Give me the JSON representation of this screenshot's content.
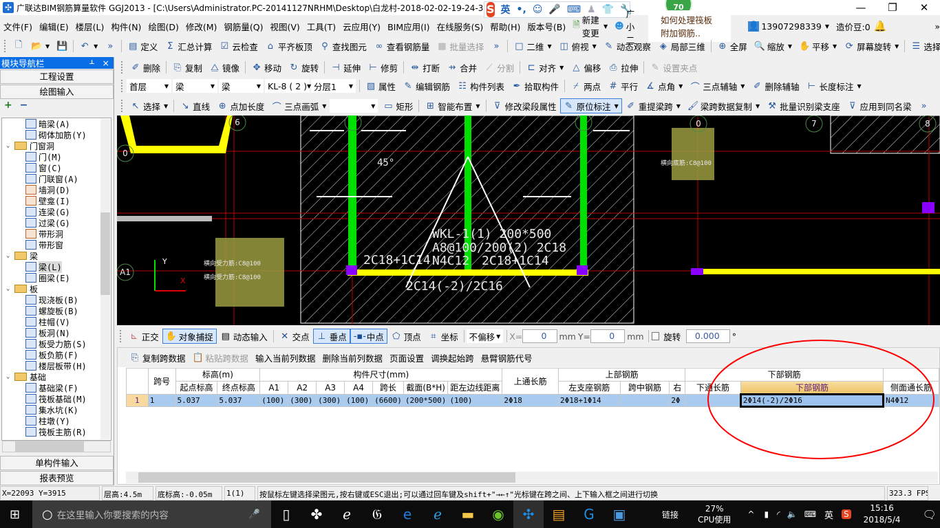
{
  "titlebar": {
    "title": "广联达BIM钢筋算量软件 GGJ2013 - [C:\\Users\\Administrator.PC-20141127NRHM\\Desktop\\白龙村-2018-02-02-19-24-35",
    "ime_lang": "英",
    "badge": "70",
    "minimize": "—",
    "restore": "❐",
    "close": "✕"
  },
  "menu": {
    "items": [
      "文件(F)",
      "编辑(E)",
      "楼层(L)",
      "构件(N)",
      "绘图(D)",
      "修改(M)",
      "钢筋量(Q)",
      "视图(V)",
      "工具(T)",
      "云应用(Y)",
      "BIM应用(I)",
      "在线服务(S)",
      "帮助(H)",
      "版本号(B)"
    ],
    "new_change": "新建变更",
    "assistant": "广小二",
    "question": "如何处理筏板附加钢筋..",
    "account": "13907298339",
    "beans": "造价豆:0"
  },
  "toolbar1": [
    {
      "label": "",
      "icon": "new-file-icon",
      "g": "🗋"
    },
    {
      "label": "",
      "icon": "open-folder-icon",
      "g": "📂",
      "dd": true
    },
    {
      "label": "",
      "icon": "save-icon",
      "g": "💾"
    },
    {
      "sep": true
    },
    {
      "label": "",
      "icon": "undo-icon",
      "g": "↶",
      "dd": true
    },
    {
      "label": "",
      "icon": "more-icon",
      "g": "»"
    },
    {
      "sep": true
    },
    {
      "label": "定义",
      "icon": "define-icon",
      "g": "▤"
    },
    {
      "label": "汇总计算",
      "icon": "sigma-icon",
      "g": "Σ"
    },
    {
      "label": "云检查",
      "icon": "cloud-check-icon",
      "g": "☑"
    },
    {
      "label": "平齐板顶",
      "icon": "align-top-icon",
      "g": "⌂"
    },
    {
      "label": "查找图元",
      "icon": "binoculars-icon",
      "g": "⚲"
    },
    {
      "label": "查看钢筋量",
      "icon": "glasses-icon",
      "g": "∞"
    },
    {
      "label": "批量选择",
      "icon": "batch-select-icon",
      "g": "▦",
      "disabled": true
    },
    {
      "label": "",
      "icon": "more-icon",
      "g": "»"
    },
    {
      "sep": true
    },
    {
      "label": "二维",
      "icon": "2d-icon",
      "g": "□",
      "dd": true
    },
    {
      "label": "俯视",
      "icon": "top-view-icon",
      "g": "◫",
      "dd": true
    },
    {
      "label": "动态观察",
      "icon": "orbit-icon",
      "g": "✎"
    },
    {
      "label": "局部三维",
      "icon": "local-3d-icon",
      "g": "◈"
    },
    {
      "sep": true
    },
    {
      "label": "全屏",
      "icon": "fullscreen-icon",
      "g": "⊕"
    },
    {
      "label": "缩放",
      "icon": "zoom-icon",
      "g": "🔍",
      "dd": true
    },
    {
      "label": "平移",
      "icon": "pan-icon",
      "g": "✋",
      "dd": true
    },
    {
      "label": "屏幕旋转",
      "icon": "screen-rotate-icon",
      "g": "⟳",
      "dd": true
    },
    {
      "sep": true
    },
    {
      "label": "选择楼层",
      "icon": "select-floor-icon",
      "g": "☰"
    }
  ],
  "toolbar2": [
    {
      "label": "删除",
      "icon": "delete-icon",
      "g": "✐"
    },
    {
      "sep": true
    },
    {
      "label": "复制",
      "icon": "copy-icon",
      "g": "⎘"
    },
    {
      "label": "镜像",
      "icon": "mirror-icon",
      "g": "⧋"
    },
    {
      "sep": true
    },
    {
      "label": "移动",
      "icon": "move-icon",
      "g": "✥"
    },
    {
      "label": "旋转",
      "icon": "rotate-icon",
      "g": "↻"
    },
    {
      "sep": true
    },
    {
      "label": "延伸",
      "icon": "extend-icon",
      "g": "⊣"
    },
    {
      "label": "修剪",
      "icon": "trim-icon",
      "g": "⊢"
    },
    {
      "sep": true
    },
    {
      "label": "打断",
      "icon": "break-icon",
      "g": "⇹"
    },
    {
      "label": "合并",
      "icon": "merge-icon",
      "g": "⇸"
    },
    {
      "label": "分割",
      "icon": "split-icon",
      "g": "⟋",
      "disabled": true
    },
    {
      "sep": true
    },
    {
      "label": "对齐",
      "icon": "align-icon",
      "g": "⊏",
      "dd": true
    },
    {
      "label": "偏移",
      "icon": "offset-icon",
      "g": "△"
    },
    {
      "label": "拉伸",
      "icon": "stretch-icon",
      "g": "⎙"
    },
    {
      "sep": true
    },
    {
      "label": "设置夹点",
      "icon": "grip-point-icon",
      "g": "✎",
      "disabled": true
    }
  ],
  "toolbar3": {
    "selects": [
      {
        "value": "首层",
        "w": 65
      },
      {
        "value": "梁",
        "w": 55
      },
      {
        "value": "梁",
        "w": 55
      },
      {
        "value": "KL-8 ( 2 )",
        "w": 55
      },
      {
        "value": "分层1",
        "w": 55
      }
    ],
    "items": [
      {
        "sep": true
      },
      {
        "label": "属性",
        "icon": "properties-icon",
        "g": "▧"
      },
      {
        "label": "编辑钢筋",
        "icon": "edit-rebar-icon",
        "g": "✎"
      },
      {
        "label": "构件列表",
        "icon": "component-list-icon",
        "g": "☷"
      },
      {
        "label": "拾取构件",
        "icon": "eyedropper-icon",
        "g": "✒"
      },
      {
        "sep": true
      },
      {
        "label": "两点",
        "icon": "two-point-icon",
        "g": "⌿"
      },
      {
        "label": "平行",
        "icon": "parallel-icon",
        "g": "#"
      },
      {
        "label": "点角",
        "icon": "point-angle-icon",
        "g": "∡",
        "dd": true
      },
      {
        "label": "三点辅轴",
        "icon": "three-point-axis-icon",
        "g": "⌒",
        "dd": true
      },
      {
        "label": "删除辅轴",
        "icon": "delete-axis-icon",
        "g": "✐"
      },
      {
        "label": "长度标注",
        "icon": "length-dimension-icon",
        "g": "⊢",
        "dd": true
      }
    ]
  },
  "toolbar4": [
    {
      "label": "选择",
      "icon": "cursor-icon",
      "g": "↖",
      "dd": true
    },
    {
      "sep": true
    },
    {
      "label": "直线",
      "icon": "line-icon",
      "g": "↘"
    },
    {
      "label": "点加长度",
      "icon": "point-length-icon",
      "g": "⊕"
    },
    {
      "label": "三点画弧",
      "icon": "arc-icon",
      "g": "⌒",
      "dd": true
    },
    {
      "select": true,
      "value": ""
    },
    {
      "label": "矩形",
      "icon": "rectangle-icon",
      "g": "▭"
    },
    {
      "sep": true
    },
    {
      "label": "智能布置",
      "icon": "smart-layout-icon",
      "g": "⊞",
      "dd": true
    },
    {
      "sep": true
    },
    {
      "label": "修改梁段属性",
      "icon": "filter-icon",
      "g": "⊽"
    },
    {
      "label": "原位标注",
      "icon": "in-place-annotation-icon",
      "g": "✎",
      "active": true,
      "dd": true
    },
    {
      "label": "重提梁跨",
      "icon": "re-extract-span-icon",
      "g": "✐",
      "dd": true
    },
    {
      "label": "梁跨数据复制",
      "icon": "brush-icon",
      "g": "🖌",
      "dd": true
    },
    {
      "label": "批量识别梁支座",
      "icon": "batch-support-icon",
      "g": "⚒"
    },
    {
      "label": "应用到同名梁",
      "icon": "apply-same-name-icon",
      "g": "⊽"
    },
    {
      "label": "",
      "icon": "more-icon",
      "g": "»"
    }
  ],
  "left_panel": {
    "title": "模块导航栏",
    "pin": "ᚆ",
    "close": "×",
    "project_settings": "工程设置",
    "drawing_input": "绘图输入",
    "expand": "+",
    "collapse": "−",
    "single_input": "单构件输入",
    "report_preview": "报表预览",
    "tree": [
      {
        "l": 2,
        "t": "暗梁(A)",
        "icon": "hidden-beam-icon"
      },
      {
        "l": 2,
        "t": "砌体加筋(Y)",
        "icon": "masonry-rebar-icon"
      },
      {
        "l": 1,
        "t": "门窗洞",
        "icon": "folder-icon",
        "f": true
      },
      {
        "l": 2,
        "t": "门(M)",
        "icon": "door-icon"
      },
      {
        "l": 2,
        "t": "窗(C)",
        "icon": "window-icon"
      },
      {
        "l": 2,
        "t": "门联窗(A)",
        "icon": "door-window-icon"
      },
      {
        "l": 2,
        "t": "墙洞(D)",
        "icon": "wall-hole-icon",
        "c": "#c0622b"
      },
      {
        "l": 2,
        "t": "壁龛(I)",
        "icon": "niche-icon",
        "c": "#c0622b"
      },
      {
        "l": 2,
        "t": "连梁(G)",
        "icon": "coupling-beam-icon"
      },
      {
        "l": 2,
        "t": "过梁(G)",
        "icon": "lintel-icon"
      },
      {
        "l": 2,
        "t": "带形洞",
        "icon": "strip-hole-icon",
        "c": "#c0622b"
      },
      {
        "l": 2,
        "t": "带形窗",
        "icon": "strip-window-icon"
      },
      {
        "l": 1,
        "t": "梁",
        "icon": "folder-icon",
        "f": true
      },
      {
        "l": 2,
        "t": "梁(L)",
        "icon": "beam-icon",
        "sel": true
      },
      {
        "l": 2,
        "t": "圈梁(E)",
        "icon": "ring-beam-icon"
      },
      {
        "l": 1,
        "t": "板",
        "icon": "folder-icon",
        "f": true
      },
      {
        "l": 2,
        "t": "现浇板(B)",
        "icon": "cast-slab-icon"
      },
      {
        "l": 2,
        "t": "螺旋板(B)",
        "icon": "spiral-slab-icon"
      },
      {
        "l": 2,
        "t": "柱帽(V)",
        "icon": "column-cap-icon"
      },
      {
        "l": 2,
        "t": "板洞(N)",
        "icon": "slab-hole-icon"
      },
      {
        "l": 2,
        "t": "板受力筋(S)",
        "icon": "slab-stress-rebar-icon"
      },
      {
        "l": 2,
        "t": "板负筋(F)",
        "icon": "slab-negative-rebar-icon"
      },
      {
        "l": 2,
        "t": "楼层板带(H)",
        "icon": "floor-strip-icon"
      },
      {
        "l": 1,
        "t": "基础",
        "icon": "folder-icon",
        "f": true
      },
      {
        "l": 2,
        "t": "基础梁(F)",
        "icon": "foundation-beam-icon"
      },
      {
        "l": 2,
        "t": "筏板基础(M)",
        "icon": "raft-foundation-icon"
      },
      {
        "l": 2,
        "t": "集水坑(K)",
        "icon": "sump-icon"
      },
      {
        "l": 2,
        "t": "柱墩(Y)",
        "icon": "column-pier-icon"
      },
      {
        "l": 2,
        "t": "筏板主筋(R)",
        "icon": "raft-main-rebar-icon"
      }
    ]
  },
  "canvas": {
    "beam_label": "WKL-1(1) 200*500",
    "stirrup": "A8@100/200(2) 2C18",
    "side_bar": "N4C12",
    "left_support": "2C18+1C14",
    "right_support": "2C18+1C14",
    "bottom_bar": "2C14(-2)/2C16",
    "angle": "45°",
    "axis_a1": "A1",
    "axis_0": "0",
    "axis_6": "6",
    "axis_7": "7",
    "axis_8": "8",
    "axis_0b": "0",
    "slab_text1": "横向受力筋:C8@100",
    "slab_text2": "横向受力筋:C8@100",
    "slab_text3": "横向底筋:C8@100",
    "x_axis": "X",
    "y_axis": "Y",
    "colors": {
      "beam": "#ffff00",
      "column": "#00e000",
      "support": "#8a00ff",
      "grid": "#c00000",
      "slab": "#9b9b40"
    }
  },
  "snapbar": {
    "ortho": "正交",
    "object_snap": "对象捕捉",
    "dynamic_input": "动态输入",
    "intersection": "交点",
    "perpendicular": "垂点",
    "midpoint": "中点",
    "vertex": "顶点",
    "coordinate": "坐标",
    "offset_mode": "不偏移",
    "x_label": "X=",
    "x_value": "0",
    "y_label": "Y=",
    "y_value": "0",
    "unit": "mm",
    "rotate_label": "旋转",
    "rotate_value": "0.000",
    "degree": "°",
    "rotate_checked": false
  },
  "grid": {
    "toolbar": {
      "copy_span": "复制跨数据",
      "paste_span": "粘贴跨数据",
      "input_col": "输入当前列数据",
      "delete_col": "删除当前列数据",
      "page_setup": "页面设置",
      "swap_start": "调换起始跨",
      "cantilever": "悬臂钢筋代号"
    },
    "groups": {
      "span_no": "跨号",
      "elevation": "标高(m)",
      "dimensions": "构件尺寸(mm)",
      "top_through": "上通长筋",
      "top_rebar": "上部钢筋",
      "bottom_rebar": "下部钢筋"
    },
    "columns": {
      "start_elev": "起点标高",
      "end_elev": "终点标高",
      "a1": "A1",
      "a2": "A2",
      "a3": "A3",
      "a4": "A4",
      "span_len": "跨长",
      "section": "截面(B*H)",
      "dist_left": "距左边线距离",
      "left_support": "左支座钢筋",
      "mid_span": "跨中钢筋",
      "right": "右",
      "bottom_through": "下通长筋",
      "bottom": "下部钢筋",
      "side_through": "侧面通长筋"
    },
    "rows": [
      {
        "index": "1",
        "span_no": "1",
        "start_elev": "5.037",
        "end_elev": "5.037",
        "a1": "(100)",
        "a2": "(300)",
        "a3": "(300)",
        "a4": "(100)",
        "span_len": "(6600)",
        "section": "(200*500)",
        "dist_left": "(100)",
        "top_through": "2Φ18",
        "left_support": "2Φ18+1Φ14",
        "mid_span": "",
        "right": "2Φ",
        "bottom_through": "",
        "bottom": "2Φ14(-2)/2Φ16",
        "side_through": "N4Φ12"
      }
    ]
  },
  "statusbar": {
    "coords": "X=22093 Y=3915",
    "floor_height": "层高:4.5m",
    "base_elev": "底标高:-0.05m",
    "layer": "1(1)",
    "message": "按鼠标左键选择梁图元,按右键或ESC退出;可以通过回车键及shift+\"→←↑\"光标键在跨之间、上下输入框之间进行切换",
    "fps": "323.3 FPS"
  },
  "taskbar": {
    "search_placeholder": "在这里输入你要搜索的内容",
    "links": "链接",
    "cpu_percent": "27%",
    "cpu_label": "CPU使用",
    "ime": "英",
    "time": "15:16",
    "date": "2018/5/4"
  }
}
